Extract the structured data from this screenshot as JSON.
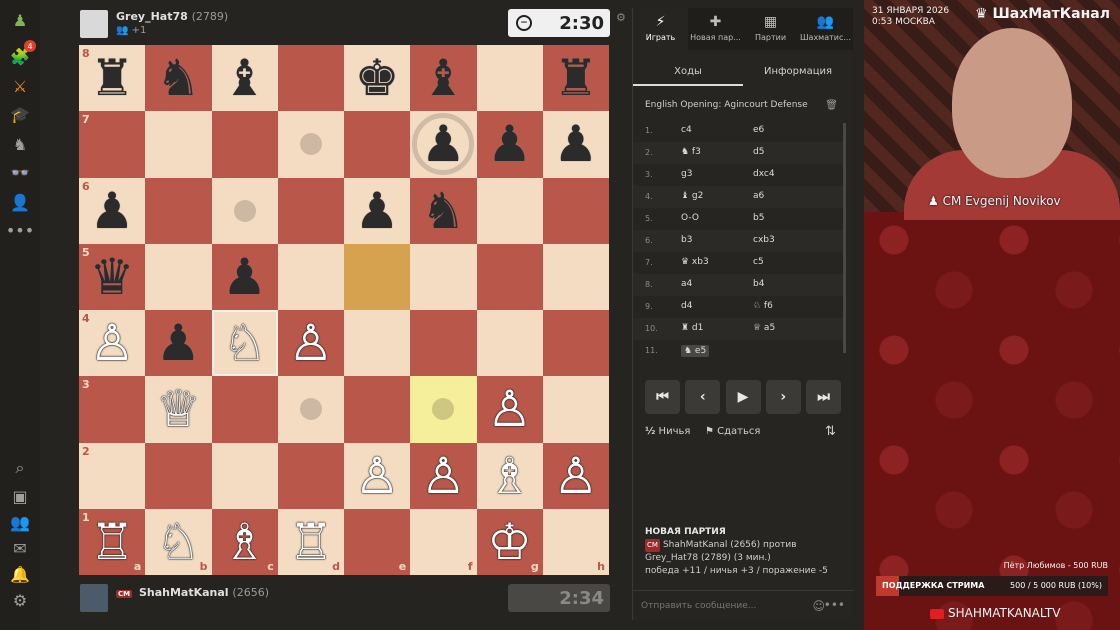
{
  "colors": {
    "accent": "#81b64c",
    "board_light": "#f4dcc3",
    "board_dark": "#b9584a",
    "highlight": "#d6a24f",
    "stream_red": "#6b1515"
  },
  "nav": {
    "icons": [
      "chess-logo-icon",
      "puzzle-icon",
      "play-icon",
      "learn-icon",
      "watch-icon",
      "friends-icon",
      "community-icon",
      "more-icon"
    ],
    "badge": "4",
    "bottom_icons": [
      "search-icon",
      "profile-icon",
      "friends-icon",
      "mail-icon",
      "bell-icon",
      "gear-icon"
    ]
  },
  "top_player": {
    "name": "Grey_Hat78",
    "rating": "(2789)",
    "extra": "+1",
    "clock": "2:30"
  },
  "bottom_player": {
    "title": "CM",
    "name": "ShahMatKanal",
    "rating": "(2656)",
    "clock": "2:34"
  },
  "board": {
    "ranks": [
      "8",
      "7",
      "6",
      "5",
      "4",
      "3",
      "2",
      "1"
    ],
    "files": [
      "a",
      "b",
      "c",
      "d",
      "e",
      "f",
      "g",
      "h"
    ],
    "pieces": [
      {
        "sq": "a8",
        "p": "♜",
        "c": "b"
      },
      {
        "sq": "b8",
        "p": "♞",
        "c": "b"
      },
      {
        "sq": "c8",
        "p": "♝",
        "c": "b"
      },
      {
        "sq": "e8",
        "p": "♚",
        "c": "b"
      },
      {
        "sq": "f8",
        "p": "♝",
        "c": "b"
      },
      {
        "sq": "h8",
        "p": "♜",
        "c": "b"
      },
      {
        "sq": "f7",
        "p": "♟",
        "c": "b"
      },
      {
        "sq": "g7",
        "p": "♟",
        "c": "b"
      },
      {
        "sq": "h7",
        "p": "♟",
        "c": "b"
      },
      {
        "sq": "a6",
        "p": "♟",
        "c": "b"
      },
      {
        "sq": "e6",
        "p": "♟",
        "c": "b"
      },
      {
        "sq": "f6",
        "p": "♞",
        "c": "b"
      },
      {
        "sq": "a5",
        "p": "♛",
        "c": "b"
      },
      {
        "sq": "c5",
        "p": "♟",
        "c": "b"
      },
      {
        "sq": "a4",
        "p": "♙",
        "c": "w"
      },
      {
        "sq": "b4",
        "p": "♟",
        "c": "b"
      },
      {
        "sq": "c4",
        "p": "♘",
        "c": "w"
      },
      {
        "sq": "d4",
        "p": "♙",
        "c": "w"
      },
      {
        "sq": "b3",
        "p": "♕",
        "c": "w"
      },
      {
        "sq": "g3",
        "p": "♙",
        "c": "w"
      },
      {
        "sq": "e2",
        "p": "♙",
        "c": "w"
      },
      {
        "sq": "f2",
        "p": "♙",
        "c": "w"
      },
      {
        "sq": "g2",
        "p": "♗",
        "c": "w"
      },
      {
        "sq": "h2",
        "p": "♙",
        "c": "w"
      },
      {
        "sq": "a1",
        "p": "♖",
        "c": "w"
      },
      {
        "sq": "b1",
        "p": "♘",
        "c": "w"
      },
      {
        "sq": "c1",
        "p": "♗",
        "c": "w"
      },
      {
        "sq": "d1",
        "p": "♖",
        "c": "w"
      },
      {
        "sq": "g1",
        "p": "♔",
        "c": "w"
      }
    ],
    "highlights": [
      {
        "sq": "e5",
        "kind": "dark"
      },
      {
        "sq": "f3",
        "kind": "light"
      }
    ],
    "dots": [
      "d7",
      "c6",
      "d3",
      "f3"
    ],
    "rings": [
      "f7"
    ],
    "selected": "c4"
  },
  "panel": {
    "tabs": [
      {
        "label": "Играть",
        "icon": "⚡"
      },
      {
        "label": "Новая пар...",
        "icon": "✚"
      },
      {
        "label": "Партии",
        "icon": "▦"
      },
      {
        "label": "Шахматис...",
        "icon": "👥"
      }
    ],
    "subtabs": [
      "Ходы",
      "Информация"
    ],
    "opening": "English Opening: Agincourt Defense",
    "moves": [
      {
        "n": "1.",
        "w": "c4",
        "b": "e6"
      },
      {
        "n": "2.",
        "w": "♞ f3",
        "b": "d5"
      },
      {
        "n": "3.",
        "w": "g3",
        "b": "dxc4"
      },
      {
        "n": "4.",
        "w": "♝ g2",
        "b": "a6"
      },
      {
        "n": "5.",
        "w": "O-O",
        "b": "b5"
      },
      {
        "n": "6.",
        "w": "b3",
        "b": "cxb3"
      },
      {
        "n": "7.",
        "w": "♛ xb3",
        "b": "c5"
      },
      {
        "n": "8.",
        "w": "a4",
        "b": "b4"
      },
      {
        "n": "9.",
        "w": "d4",
        "b": "♘ f6"
      },
      {
        "n": "10.",
        "w": "♜ d1",
        "b": "♕ a5"
      },
      {
        "n": "11.",
        "w": "♞ e5",
        "b": ""
      }
    ],
    "draw": "Ничья",
    "resign": "Сдаться",
    "new_game": {
      "title": "НОВАЯ ПАРТИЯ",
      "line1": "ShahMatKanal (2656) против",
      "line2": "Grey_Hat78 (2789) (3 мин.)",
      "line3": "победа +11 / ничья +3 / поражение -5"
    },
    "chat_placeholder": "Отправить сообщение..."
  },
  "stream": {
    "date": "31 ЯНВАРЯ 2026",
    "time": "0:53 МОСКВА",
    "brand": "ШахМатКанал",
    "caster": "CM Evgenij Novikov",
    "donor": "Пётр Любимов - 500 RUB",
    "goal_label": "ПОДДЕРЖКА СТРИМА",
    "goal_value": "500 / 5 000 RUB (10%)",
    "goal_fraction": 0.1,
    "channel": "SHAHMATKANALTV"
  }
}
